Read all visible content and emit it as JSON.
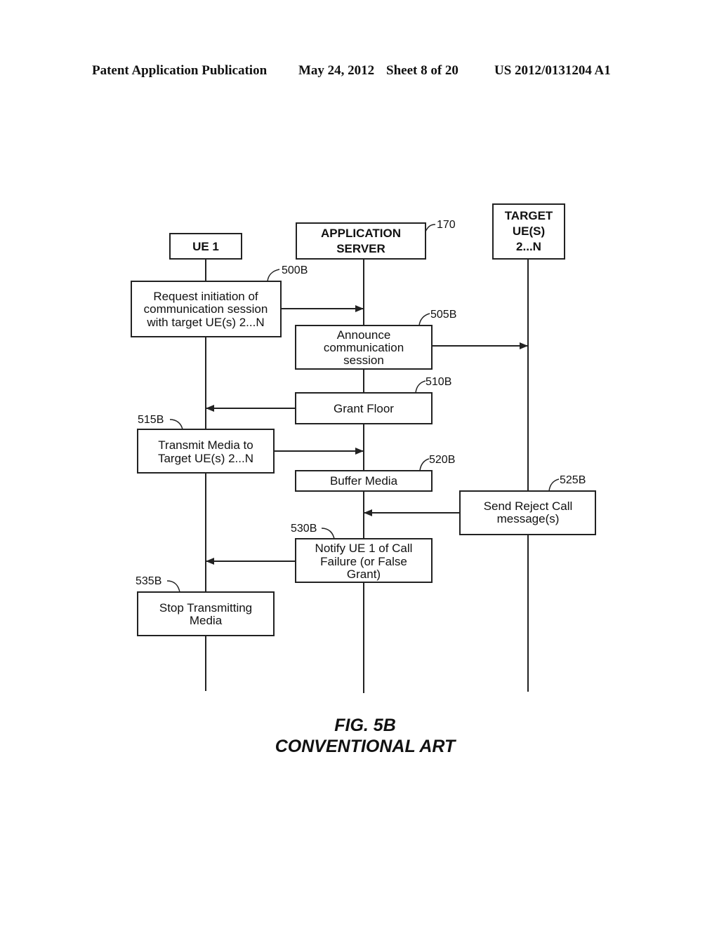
{
  "header": {
    "publication": "Patent Application Publication",
    "date": "May 24, 2012",
    "sheet": "Sheet 8 of 20",
    "number": "US 2012/0131204 A1"
  },
  "entities": {
    "ue1": {
      "label": [
        "UE 1"
      ]
    },
    "server": {
      "label": [
        "APPLICATION",
        "SERVER"
      ],
      "ref": "170"
    },
    "target": {
      "label": [
        "TARGET",
        "UE(S)",
        "2...N"
      ]
    }
  },
  "steps": {
    "s500": {
      "ref": "500B",
      "lines": [
        "Request initiation of",
        "communication session",
        "with target UE(s) 2...N"
      ]
    },
    "s505": {
      "ref": "505B",
      "lines": [
        "Announce",
        "communication",
        "session"
      ]
    },
    "s510": {
      "ref": "510B",
      "lines": [
        "Grant Floor"
      ]
    },
    "s515": {
      "ref": "515B",
      "lines": [
        "Transmit Media to",
        "Target UE(s) 2...N"
      ]
    },
    "s520": {
      "ref": "520B",
      "lines": [
        "Buffer Media"
      ]
    },
    "s525": {
      "ref": "525B",
      "lines": [
        "Send Reject Call",
        "message(s)"
      ]
    },
    "s530": {
      "ref": "530B",
      "lines": [
        "Notify UE 1 of Call",
        "Failure (or False",
        "Grant)"
      ]
    },
    "s535": {
      "ref": "535B",
      "lines": [
        "Stop Transmitting",
        "Media"
      ]
    }
  },
  "figure": {
    "title": "FIG. 5B",
    "subtitle": "CONVENTIONAL ART"
  }
}
